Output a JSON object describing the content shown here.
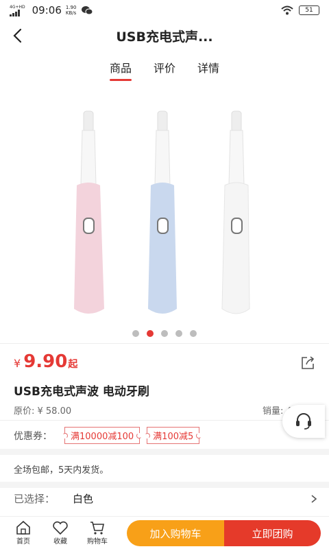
{
  "status_bar": {
    "network": "4G+HD",
    "time": "09:06",
    "speed_value": "1.90",
    "speed_unit": "KB/s",
    "battery": "51"
  },
  "header": {
    "title": "USB充电式声..."
  },
  "tabs": [
    {
      "label": "商品",
      "active": true
    },
    {
      "label": "评价",
      "active": false
    },
    {
      "label": "详情",
      "active": false
    }
  ],
  "gallery": {
    "image_count": 5,
    "active_index": 1,
    "toothbrush_colors": [
      "#f3d3dc",
      "#c9d8ee",
      "#f5f5f5"
    ]
  },
  "product": {
    "currency": "¥",
    "price": "9.90",
    "price_suffix": "起",
    "name": "USB充电式声波 电动牙刷",
    "original_price": "原价: ¥ 58.00",
    "sales": "销量: 4"
  },
  "coupons": {
    "label": "优惠券：",
    "items": [
      "满10000减100",
      "满100减5"
    ]
  },
  "shipping": "全场包邮，5天内发货。",
  "selection": {
    "label": "已选择：",
    "value": "白色"
  },
  "bottom_bar": {
    "home": "首页",
    "favorite": "收藏",
    "cart": "购物车",
    "add_to_cart": "加入购物车",
    "group_buy": "立即团购"
  },
  "colors": {
    "accent_red": "#e53935",
    "cart_orange": "#f8a018",
    "group_red": "#e53a2a"
  }
}
